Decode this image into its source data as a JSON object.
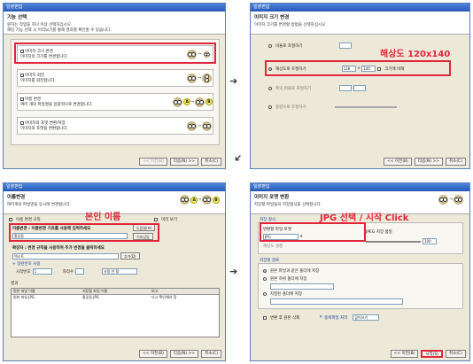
{
  "nav": {
    "back": "<< 이전(B)",
    "next": "다음(N) >>",
    "cancel": "취소(C)",
    "start": "시작(S)"
  },
  "win1": {
    "title": "일괄편집",
    "head_title": "기능 선택",
    "head_desc": "원하는 작업을 하나 이상 선택하십시오.\n해당 기능 선택 시 미리보기를 통해 결과를 확인할 수 있습니다.",
    "options": [
      {
        "title": "이미지 크기 변경",
        "desc": "이미지의 크기를 변경합니다."
      },
      {
        "title": "이미지 회전",
        "desc": "이미지를 회전합니다."
      },
      {
        "title": "이름 변경",
        "desc": "여러 개의 파일명을 일괄적으로 변경합니다."
      },
      {
        "title": "이미지의 포맷 변환/저장",
        "desc": "이미지의 포맷을 변환합니다."
      }
    ]
  },
  "win2": {
    "title": "일괄편집",
    "head_title": "이미지 크기 변경",
    "head_desc": "이미지 크기를 변경할 방법을 선택하십시오.",
    "opt1": "비율로 조절하기",
    "opt2": "해상도로 조절하기",
    "width": "128",
    "height": "140",
    "keep_ratio": "크기에 비례",
    "opt3": "폭의 비율로 조절하기",
    "opt4": "용량으로 조절하기",
    "annotation": "해상도 120x140"
  },
  "win3": {
    "title": "일괄편집",
    "head_title": "이름변경",
    "head_desc": "여러개의 파일명을 동시에 변경합니다.",
    "rule_label": "이름 변경 규칙",
    "preview_label": "미리 보기",
    "name_rule_label": "이름변경 : 이름변경 기호를 사용해 입력하세요",
    "name_value": "홍길동",
    "btn_sym": "도움말(H)",
    "btn_ins": "기호삽입",
    "ext_label": "확장자 : 변경 규칙을 사용하여 추가 변경을 클릭하세요",
    "ext_value": "텍스트",
    "ext_btn": "추가(D)",
    "serial_label": "+ 일련번호 사용",
    "start_label": "시작번호",
    "start_value": "1",
    "digit_label": "자리수",
    "case_value": "사용 안 함",
    "list_title": "결과",
    "cols": [
      "원본 파일 이름",
      "저장될 파일 이름",
      "비고"
    ],
    "rows": [
      [
        "원본 파일.JPG",
        "홍길동.JPG",
        "다시 확인해야 함"
      ]
    ],
    "annotation": "본인 이름"
  },
  "win4": {
    "title": "일괄편집",
    "head_title": "이미지 포맷 변환",
    "head_desc": "저장할 파일들의 저장형식을 선택합니다.",
    "format_group": "저장 형식",
    "format_label": "변환할 파일 포맷",
    "format_value": "JPG",
    "quality_label": "JPEG 저장 품질",
    "quality_value": "100",
    "dpi_label": "해상도 설정",
    "path_group": "저장할 경로",
    "path1": "원본 파일과 같은 폴더에 저장",
    "path2": "원본 하위 폴더에 저장",
    "path3": "지정된 폴더에 저장",
    "overwrite": "변환 후 원본 삭제",
    "same_name": "중복파일 처리",
    "same_value": "덮어쓰기",
    "annotation": "JPG 선택 / 시작 Click"
  },
  "colors": {
    "annotation": "#e2263a",
    "title_bar": "#2758b6"
  }
}
